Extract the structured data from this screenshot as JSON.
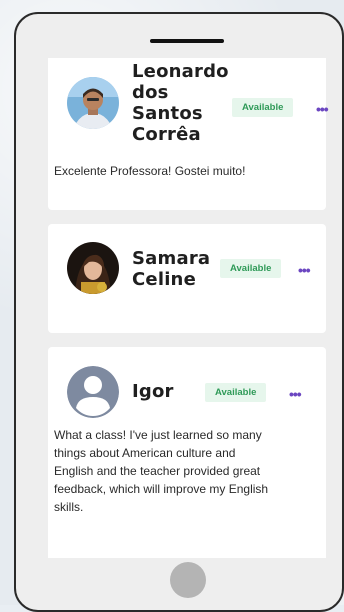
{
  "reviews": [
    {
      "name_lines": [
        "Leonardo",
        "dos",
        "Santos",
        "Corrêa"
      ],
      "status": "Available",
      "more": "•••",
      "comment_lines": [
        "Excelente Professora! Gostei muito!"
      ]
    },
    {
      "name_lines": [
        "Samara",
        "Celine"
      ],
      "status": "Available",
      "more": "•••",
      "comment_lines": []
    },
    {
      "name_lines": [
        "Igor"
      ],
      "status": "Available",
      "more": "•••",
      "comment_lines": [
        "What a class! I've just learned so many",
        "things about American culture and",
        "English and the teacher provided great",
        "feedback, which will improve my English",
        "skills."
      ]
    }
  ],
  "colors": {
    "badge_bg": "#e6f6ec",
    "badge_text": "#2f9a58",
    "more_icon": "#6b46c1"
  },
  "icons": {
    "more": "more-options-icon",
    "home": "home-button",
    "default_avatar": "user-placeholder-icon"
  }
}
